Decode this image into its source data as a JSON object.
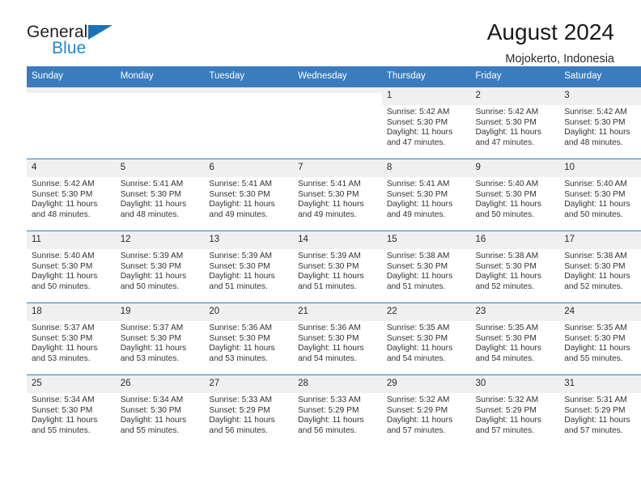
{
  "brand": {
    "name_part1": "General",
    "name_part2": "Blue",
    "triangle_color": "#1a72b8",
    "blue_color": "#1f87d0"
  },
  "header": {
    "title": "August 2024",
    "subtitle": "Mojokerto, Indonesia"
  },
  "theme": {
    "header_bg": "#3a7cbe",
    "daynum_bg": "#f0f0f0",
    "row_border": "#3a7cbe",
    "text": "#333333"
  },
  "weekdays": [
    "Sunday",
    "Monday",
    "Tuesday",
    "Wednesday",
    "Thursday",
    "Friday",
    "Saturday"
  ],
  "labels": {
    "sunrise_prefix": "Sunrise:",
    "sunset_prefix": "Sunset:",
    "daylight_prefix": "Daylight:"
  },
  "weeks": [
    [
      {
        "empty": true
      },
      {
        "empty": true
      },
      {
        "empty": true
      },
      {
        "empty": true
      },
      {
        "day": "1",
        "sunrise": "Sunrise: 5:42 AM",
        "sunset": "Sunset: 5:30 PM",
        "daylight1": "Daylight: 11 hours",
        "daylight2": "and 47 minutes."
      },
      {
        "day": "2",
        "sunrise": "Sunrise: 5:42 AM",
        "sunset": "Sunset: 5:30 PM",
        "daylight1": "Daylight: 11 hours",
        "daylight2": "and 47 minutes."
      },
      {
        "day": "3",
        "sunrise": "Sunrise: 5:42 AM",
        "sunset": "Sunset: 5:30 PM",
        "daylight1": "Daylight: 11 hours",
        "daylight2": "and 48 minutes."
      }
    ],
    [
      {
        "day": "4",
        "sunrise": "Sunrise: 5:42 AM",
        "sunset": "Sunset: 5:30 PM",
        "daylight1": "Daylight: 11 hours",
        "daylight2": "and 48 minutes."
      },
      {
        "day": "5",
        "sunrise": "Sunrise: 5:41 AM",
        "sunset": "Sunset: 5:30 PM",
        "daylight1": "Daylight: 11 hours",
        "daylight2": "and 48 minutes."
      },
      {
        "day": "6",
        "sunrise": "Sunrise: 5:41 AM",
        "sunset": "Sunset: 5:30 PM",
        "daylight1": "Daylight: 11 hours",
        "daylight2": "and 49 minutes."
      },
      {
        "day": "7",
        "sunrise": "Sunrise: 5:41 AM",
        "sunset": "Sunset: 5:30 PM",
        "daylight1": "Daylight: 11 hours",
        "daylight2": "and 49 minutes."
      },
      {
        "day": "8",
        "sunrise": "Sunrise: 5:41 AM",
        "sunset": "Sunset: 5:30 PM",
        "daylight1": "Daylight: 11 hours",
        "daylight2": "and 49 minutes."
      },
      {
        "day": "9",
        "sunrise": "Sunrise: 5:40 AM",
        "sunset": "Sunset: 5:30 PM",
        "daylight1": "Daylight: 11 hours",
        "daylight2": "and 50 minutes."
      },
      {
        "day": "10",
        "sunrise": "Sunrise: 5:40 AM",
        "sunset": "Sunset: 5:30 PM",
        "daylight1": "Daylight: 11 hours",
        "daylight2": "and 50 minutes."
      }
    ],
    [
      {
        "day": "11",
        "sunrise": "Sunrise: 5:40 AM",
        "sunset": "Sunset: 5:30 PM",
        "daylight1": "Daylight: 11 hours",
        "daylight2": "and 50 minutes."
      },
      {
        "day": "12",
        "sunrise": "Sunrise: 5:39 AM",
        "sunset": "Sunset: 5:30 PM",
        "daylight1": "Daylight: 11 hours",
        "daylight2": "and 50 minutes."
      },
      {
        "day": "13",
        "sunrise": "Sunrise: 5:39 AM",
        "sunset": "Sunset: 5:30 PM",
        "daylight1": "Daylight: 11 hours",
        "daylight2": "and 51 minutes."
      },
      {
        "day": "14",
        "sunrise": "Sunrise: 5:39 AM",
        "sunset": "Sunset: 5:30 PM",
        "daylight1": "Daylight: 11 hours",
        "daylight2": "and 51 minutes."
      },
      {
        "day": "15",
        "sunrise": "Sunrise: 5:38 AM",
        "sunset": "Sunset: 5:30 PM",
        "daylight1": "Daylight: 11 hours",
        "daylight2": "and 51 minutes."
      },
      {
        "day": "16",
        "sunrise": "Sunrise: 5:38 AM",
        "sunset": "Sunset: 5:30 PM",
        "daylight1": "Daylight: 11 hours",
        "daylight2": "and 52 minutes."
      },
      {
        "day": "17",
        "sunrise": "Sunrise: 5:38 AM",
        "sunset": "Sunset: 5:30 PM",
        "daylight1": "Daylight: 11 hours",
        "daylight2": "and 52 minutes."
      }
    ],
    [
      {
        "day": "18",
        "sunrise": "Sunrise: 5:37 AM",
        "sunset": "Sunset: 5:30 PM",
        "daylight1": "Daylight: 11 hours",
        "daylight2": "and 53 minutes."
      },
      {
        "day": "19",
        "sunrise": "Sunrise: 5:37 AM",
        "sunset": "Sunset: 5:30 PM",
        "daylight1": "Daylight: 11 hours",
        "daylight2": "and 53 minutes."
      },
      {
        "day": "20",
        "sunrise": "Sunrise: 5:36 AM",
        "sunset": "Sunset: 5:30 PM",
        "daylight1": "Daylight: 11 hours",
        "daylight2": "and 53 minutes."
      },
      {
        "day": "21",
        "sunrise": "Sunrise: 5:36 AM",
        "sunset": "Sunset: 5:30 PM",
        "daylight1": "Daylight: 11 hours",
        "daylight2": "and 54 minutes."
      },
      {
        "day": "22",
        "sunrise": "Sunrise: 5:35 AM",
        "sunset": "Sunset: 5:30 PM",
        "daylight1": "Daylight: 11 hours",
        "daylight2": "and 54 minutes."
      },
      {
        "day": "23",
        "sunrise": "Sunrise: 5:35 AM",
        "sunset": "Sunset: 5:30 PM",
        "daylight1": "Daylight: 11 hours",
        "daylight2": "and 54 minutes."
      },
      {
        "day": "24",
        "sunrise": "Sunrise: 5:35 AM",
        "sunset": "Sunset: 5:30 PM",
        "daylight1": "Daylight: 11 hours",
        "daylight2": "and 55 minutes."
      }
    ],
    [
      {
        "day": "25",
        "sunrise": "Sunrise: 5:34 AM",
        "sunset": "Sunset: 5:30 PM",
        "daylight1": "Daylight: 11 hours",
        "daylight2": "and 55 minutes."
      },
      {
        "day": "26",
        "sunrise": "Sunrise: 5:34 AM",
        "sunset": "Sunset: 5:30 PM",
        "daylight1": "Daylight: 11 hours",
        "daylight2": "and 55 minutes."
      },
      {
        "day": "27",
        "sunrise": "Sunrise: 5:33 AM",
        "sunset": "Sunset: 5:29 PM",
        "daylight1": "Daylight: 11 hours",
        "daylight2": "and 56 minutes."
      },
      {
        "day": "28",
        "sunrise": "Sunrise: 5:33 AM",
        "sunset": "Sunset: 5:29 PM",
        "daylight1": "Daylight: 11 hours",
        "daylight2": "and 56 minutes."
      },
      {
        "day": "29",
        "sunrise": "Sunrise: 5:32 AM",
        "sunset": "Sunset: 5:29 PM",
        "daylight1": "Daylight: 11 hours",
        "daylight2": "and 57 minutes."
      },
      {
        "day": "30",
        "sunrise": "Sunrise: 5:32 AM",
        "sunset": "Sunset: 5:29 PM",
        "daylight1": "Daylight: 11 hours",
        "daylight2": "and 57 minutes."
      },
      {
        "day": "31",
        "sunrise": "Sunrise: 5:31 AM",
        "sunset": "Sunset: 5:29 PM",
        "daylight1": "Daylight: 11 hours",
        "daylight2": "and 57 minutes."
      }
    ]
  ]
}
